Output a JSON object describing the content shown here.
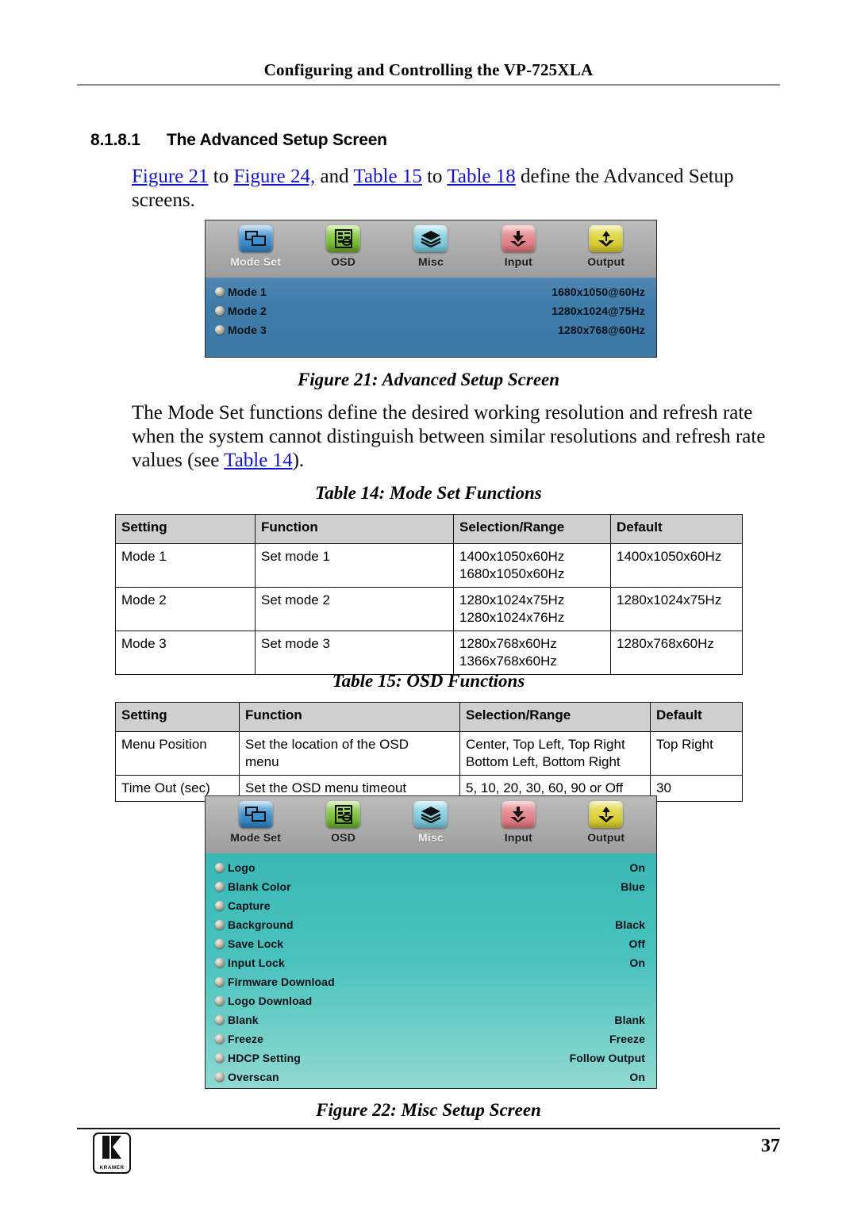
{
  "header": {
    "running_title": "Configuring and Controlling the VP-725XLA"
  },
  "section": {
    "number": "8.1.8.1",
    "title": "The Advanced Setup Screen"
  },
  "paragraphs": {
    "intro": {
      "link1": "Figure 21",
      "text1": " to ",
      "link2": "Figure 24,",
      "text2": " and ",
      "link3": "Table 15",
      "text3": " to ",
      "link4": "Table 18",
      "text4": " define the Advanced Setup screens."
    },
    "modeset": {
      "text1": "The Mode Set functions define the desired working resolution and refresh rate when the system cannot distinguish between similar resolutions and refresh rate values (see ",
      "link1": "Table 14",
      "text2": ")."
    }
  },
  "figures": {
    "fig21": {
      "caption": "Figure 21: Advanced Setup Screen",
      "toolbar": [
        {
          "label": "Mode Set",
          "icon": "windows-overlap-icon",
          "color": "#3f90cf",
          "active": true
        },
        {
          "label": "OSD",
          "icon": "osd-list-icon",
          "color": "#7fc33a",
          "active": false
        },
        {
          "label": "Misc",
          "icon": "stacked-layers-icon",
          "color": "#83d0e2",
          "active": false
        },
        {
          "label": "Input",
          "icon": "arrow-down-into-tray-icon",
          "color": "#e4868c",
          "active": false
        },
        {
          "label": "Output",
          "icon": "arrow-up-from-tray-icon",
          "color": "#ded33e",
          "active": false
        }
      ],
      "rows": [
        {
          "name": "Mode 1",
          "value": "1680x1050@60Hz"
        },
        {
          "name": "Mode 2",
          "value": "1280x1024@75Hz"
        },
        {
          "name": "Mode 3",
          "value": "1280x768@60Hz"
        }
      ]
    },
    "fig22": {
      "caption": "Figure 22: Misc Setup Screen",
      "toolbar": [
        {
          "label": "Mode Set",
          "icon": "windows-overlap-icon",
          "color": "#3f90cf",
          "active": false
        },
        {
          "label": "OSD",
          "icon": "osd-list-icon",
          "color": "#7fc33a",
          "active": false
        },
        {
          "label": "Misc",
          "icon": "stacked-layers-icon",
          "color": "#83d0e2",
          "active": true
        },
        {
          "label": "Input",
          "icon": "arrow-down-into-tray-icon",
          "color": "#e4868c",
          "active": false
        },
        {
          "label": "Output",
          "icon": "arrow-up-from-tray-icon",
          "color": "#ded33e",
          "active": false
        }
      ],
      "rows": [
        {
          "name": "Logo",
          "value": "On"
        },
        {
          "name": "Blank Color",
          "value": "Blue"
        },
        {
          "name": "Capture",
          "value": ""
        },
        {
          "name": "Background",
          "value": "Black"
        },
        {
          "name": "Save Lock",
          "value": "Off"
        },
        {
          "name": "Input Lock",
          "value": "On"
        },
        {
          "name": "Firmware Download",
          "value": ""
        },
        {
          "name": "Logo Download",
          "value": ""
        },
        {
          "name": "Blank",
          "value": "Blank"
        },
        {
          "name": "Freeze",
          "value": "Freeze"
        },
        {
          "name": "HDCP Setting",
          "value": "Follow Output"
        },
        {
          "name": "Overscan",
          "value": "On"
        }
      ]
    }
  },
  "tables": {
    "table14": {
      "caption": "Table 14: Mode Set Functions",
      "columns": [
        "Setting",
        "Function",
        "Selection/Range",
        "Default"
      ],
      "rows": [
        {
          "setting": "Mode 1",
          "function": "Set mode 1",
          "selection": [
            "1400x1050x60Hz",
            "1680x1050x60Hz"
          ],
          "default": "1400x1050x60Hz"
        },
        {
          "setting": "Mode 2",
          "function": "Set mode 2",
          "selection": [
            "1280x1024x75Hz",
            "1280x1024x76Hz"
          ],
          "default": "1280x1024x75Hz"
        },
        {
          "setting": "Mode 3",
          "function": "Set mode 3",
          "selection": [
            "1280x768x60Hz",
            "1366x768x60Hz"
          ],
          "default": "1280x768x60Hz"
        }
      ]
    },
    "table15": {
      "caption": "Table 15: OSD Functions",
      "columns": [
        "Setting",
        "Function",
        "Selection/Range",
        "Default"
      ],
      "rows": [
        {
          "setting": "Menu Position",
          "function": [
            "Set the location of the OSD",
            "menu"
          ],
          "selection": [
            "Center, Top Left, Top Right",
            "Bottom Left, Bottom Right"
          ],
          "default": "Top Right"
        },
        {
          "setting": "Time Out (sec)",
          "function": [
            "Set the OSD menu timeout"
          ],
          "selection": [
            "5, 10, 20, 30, 60, 90 or Off"
          ],
          "default": "30"
        }
      ]
    }
  },
  "footer": {
    "logo_word": "KRAMER",
    "page_number": "37"
  }
}
